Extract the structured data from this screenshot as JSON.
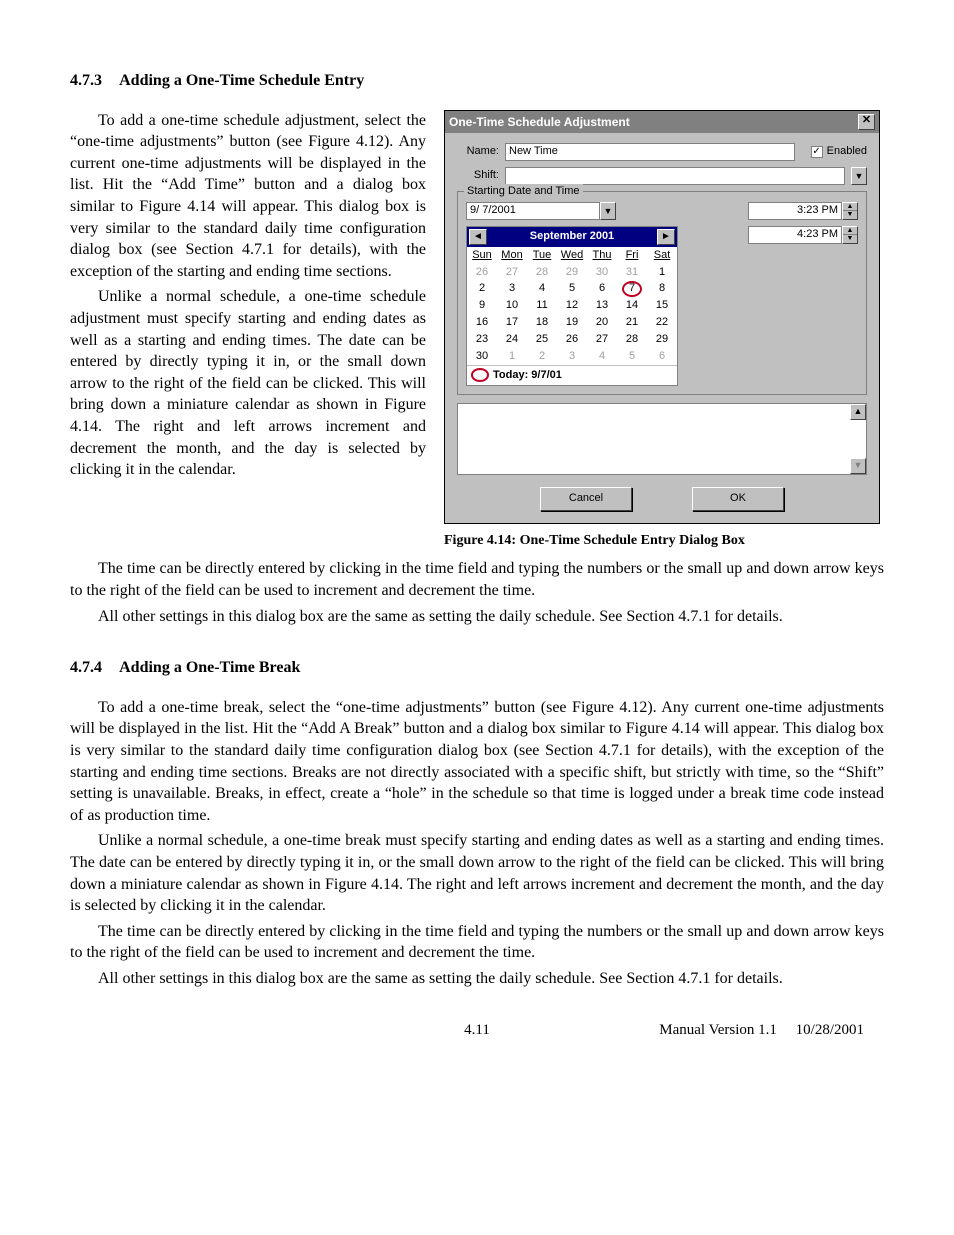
{
  "section1": {
    "number": "4.7.3",
    "title": "Adding a One-Time Schedule Entry",
    "p1": "To add a one-time schedule adjustment, select the “one-time adjustments” button (see Figure 4.12). Any current one-time adjustments will be displayed in the list.  Hit the “Add Time” button and a dialog box similar to Figure 4.14 will appear.  This dialog box is very similar to the standard daily time configuration dialog box (see Section 4.7.1 for details), with the exception of the starting and ending time sections.",
    "p2": "Unlike a normal schedule, a one-time schedule adjustment must specify starting and ending dates as well as a starting and ending times.  The date can be entered by directly typing it in, or the small down arrow to the right of the field can be clicked.  This will bring down a miniature calendar as shown in Figure 4.14.  The right and left arrows increment and decrement the month, and the day is selected by clicking it in the calendar.",
    "p3": "The time can be directly entered by clicking in the time field and typing the numbers or the small up and down arrow keys to the right of the field can be used to increment and decrement the time.",
    "p4": "All other settings in this dialog box are the same as setting the daily schedule.  See Section 4.7.1 for details."
  },
  "figure": {
    "caption": "Figure 4.14: One-Time Schedule Entry Dialog Box",
    "dialog": {
      "title": "One-Time Schedule Adjustment",
      "name_label": "Name:",
      "name_value": "New Time",
      "enabled_label": "Enabled",
      "enabled_checked": "✓",
      "shift_label": "Shift:",
      "shift_value": "",
      "group_title": "Starting Date and Time",
      "date_value": "9/ 7/2001",
      "time1": "3:23 PM",
      "time2": "4:23 PM",
      "cal_month": "September 2001",
      "dow": [
        "Sun",
        "Mon",
        "Tue",
        "Wed",
        "Thu",
        "Fri",
        "Sat"
      ],
      "weeks": [
        [
          "26",
          "27",
          "28",
          "29",
          "30",
          "31",
          "1"
        ],
        [
          "2",
          "3",
          "4",
          "5",
          "6",
          "7",
          "8"
        ],
        [
          "9",
          "10",
          "11",
          "12",
          "13",
          "14",
          "15"
        ],
        [
          "16",
          "17",
          "18",
          "19",
          "20",
          "21",
          "22"
        ],
        [
          "23",
          "24",
          "25",
          "26",
          "27",
          "28",
          "29"
        ],
        [
          "30",
          "1",
          "2",
          "3",
          "4",
          "5",
          "6"
        ]
      ],
      "gray_cells": [
        "0,0",
        "0,1",
        "0,2",
        "0,3",
        "0,4",
        "0,5",
        "5,1",
        "5,2",
        "5,3",
        "5,4",
        "5,5",
        "5,6"
      ],
      "today_cell": "1,5",
      "today_label": "Today: 9/7/01",
      "cancel": "Cancel",
      "ok": "OK"
    }
  },
  "section2": {
    "number": "4.7.4",
    "title": "Adding a One-Time Break",
    "p1": "To add a one-time break, select the “one-time adjustments” button (see Figure 4.12).  Any current one-time adjustments will be displayed in the list.  Hit the “Add A Break” button and a dialog box similar to Figure 4.14 will appear.  This dialog box is very similar to the standard daily time configuration dialog box (see Section 4.7.1 for details), with the exception of the starting and ending time sections.  Breaks are not directly associated with a specific shift, but strictly with time, so the “Shift” setting is unavailable.  Breaks, in effect, create a “hole” in the schedule so that time is logged under a break time code instead of as production time.",
    "p2": "Unlike a normal schedule, a one-time break must specify starting and ending dates as well as a starting and ending times.  The date can be entered by directly typing it in, or the small down arrow to the right of the field can be clicked.  This will bring down a miniature calendar as shown in Figure 4.14.  The right and left arrows increment and decrement the month, and the day is selected by clicking it in the calendar.",
    "p3": "The time can be directly entered by clicking in the time field and typing the numbers or the small up and down arrow keys to the right of the field can be used to increment and decrement the time.",
    "p4": "All other settings in this dialog box are the same as setting the daily schedule.  See Section 4.7.1 for details."
  },
  "footer": {
    "page": "4.11",
    "version": "Manual Version 1.1",
    "date": "10/28/2001"
  }
}
